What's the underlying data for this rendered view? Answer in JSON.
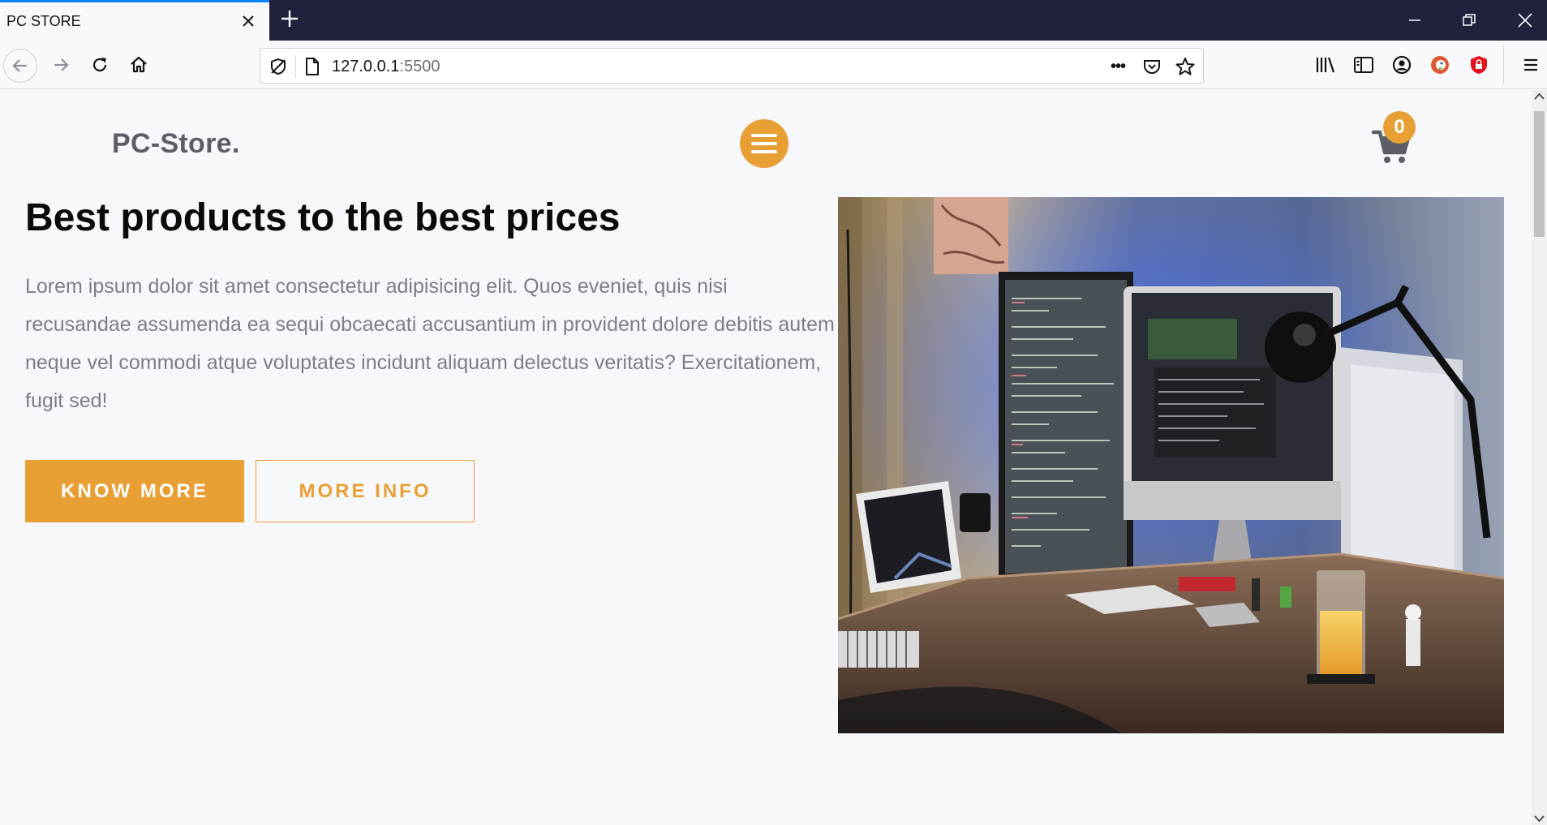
{
  "browser": {
    "tab_title": "PC STORE",
    "url_host": "127.0.0.1",
    "url_port": ":5500",
    "more_menu": "•••"
  },
  "site": {
    "logo": "PC-Store.",
    "cart_count": "0",
    "brand_color": "#e8a035"
  },
  "hero": {
    "title": "Best products to the best prices",
    "description": "Lorem ipsum dolor sit amet consectetur adipisicing elit. Quos eveniet, quis nisi recusandae assumenda ea sequi obcaecati accusantium in provident dolore debitis autem neque vel commodi atque voluptates incidunt aliquam delectus veritatis? Exercitationem, fugit sed!",
    "primary_button": "KNOW MORE",
    "secondary_button": "MORE INFO"
  }
}
